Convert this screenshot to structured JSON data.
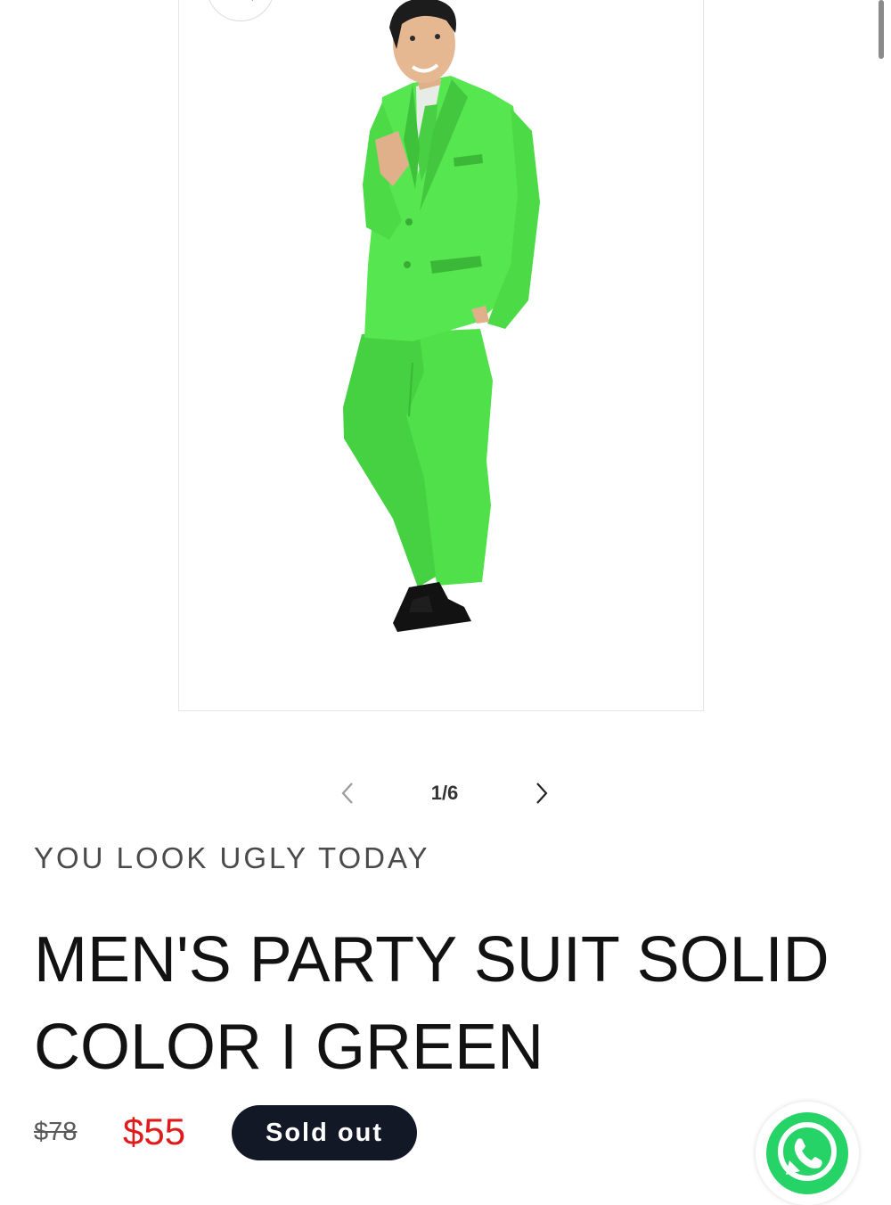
{
  "gallery": {
    "image_alt": "Man wearing a bright green party suit",
    "counter": "1/6",
    "prev_icon": "chevron-left-icon",
    "next_icon": "chevron-right-icon",
    "zoom_icon": "magnify-icon"
  },
  "product": {
    "vendor": "YOU LOOK UGLY TODAY",
    "title": "MEN'S PARTY SUIT SOLID COLOR I GREEN",
    "compare_price": "$78",
    "price": "$55",
    "badge": "Sold out"
  },
  "chat": {
    "icon": "whatsapp-icon"
  },
  "colors": {
    "suit": "#4fe04a",
    "sale_price": "#e01b1b",
    "badge_bg": "#121826",
    "whatsapp": "#25d366"
  }
}
